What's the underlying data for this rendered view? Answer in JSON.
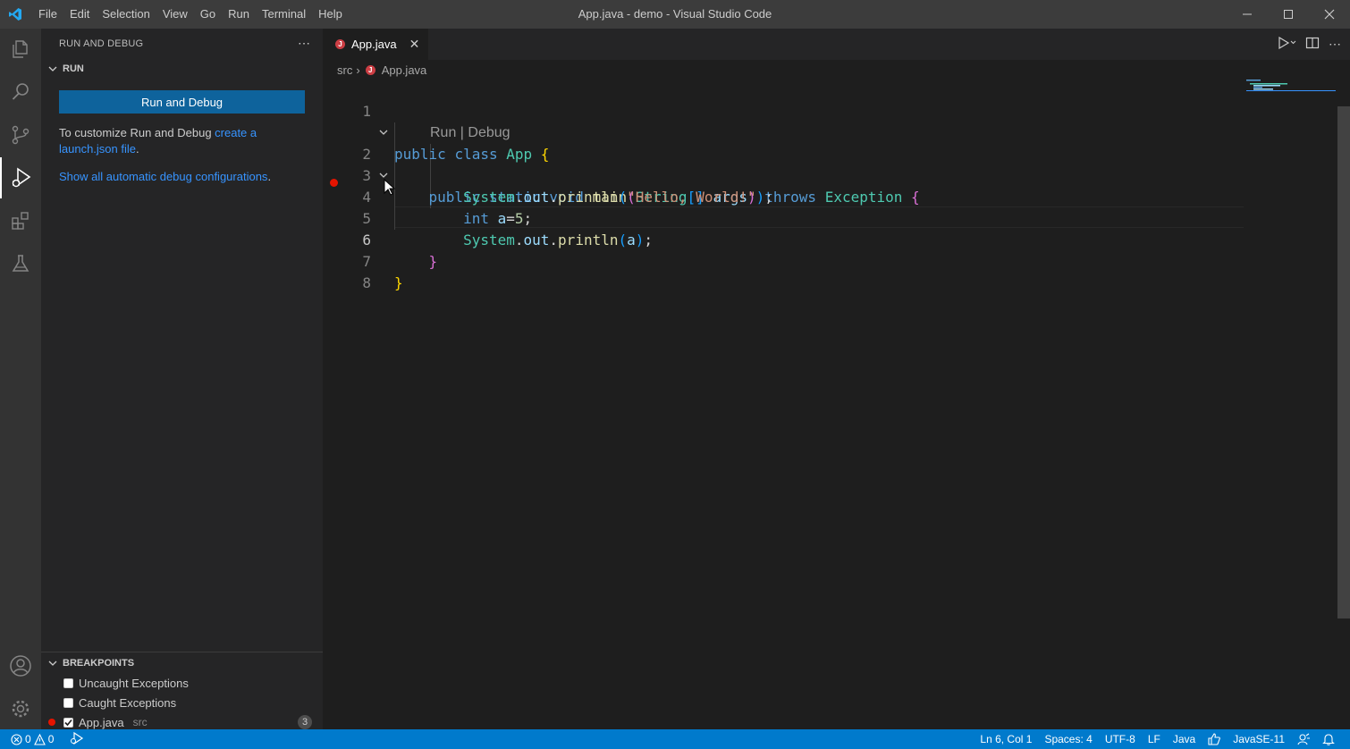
{
  "window": {
    "title": "App.java - demo - Visual Studio Code",
    "menu": [
      "File",
      "Edit",
      "Selection",
      "View",
      "Go",
      "Run",
      "Terminal",
      "Help"
    ]
  },
  "sidebar": {
    "header": "RUN AND DEBUG",
    "run_section": "RUN",
    "run_button": "Run and Debug",
    "customize_text": "To customize Run and Debug ",
    "create_link": "create a launch.json file",
    "period": ".",
    "show_configs_link": "Show all automatic debug configurations",
    "show_configs_period": ".",
    "breakpoints_section": "BREAKPOINTS",
    "breakpoints": [
      {
        "label": "Uncaught Exceptions",
        "checked": false
      },
      {
        "label": "Caught Exceptions",
        "checked": false
      },
      {
        "label": "App.java",
        "path": "src",
        "count": "3",
        "checked": true
      }
    ]
  },
  "editor": {
    "tab_label": "App.java",
    "tab_icon": "J",
    "breadcrumb": [
      "src",
      "App.java"
    ],
    "codelens": "Run | Debug",
    "line_numbers": [
      "1",
      "2",
      "3",
      "4",
      "5",
      "6",
      "7",
      "8"
    ]
  },
  "statusbar": {
    "errors": "0",
    "warnings": "0",
    "position": "Ln 6, Col 1",
    "spaces": "Spaces: 4",
    "encoding": "UTF-8",
    "eol": "LF",
    "language": "Java",
    "runtime": "JavaSE-11"
  },
  "colors": {
    "accent": "#007acc",
    "breakpoint": "#e51400",
    "link": "#3794ff"
  }
}
